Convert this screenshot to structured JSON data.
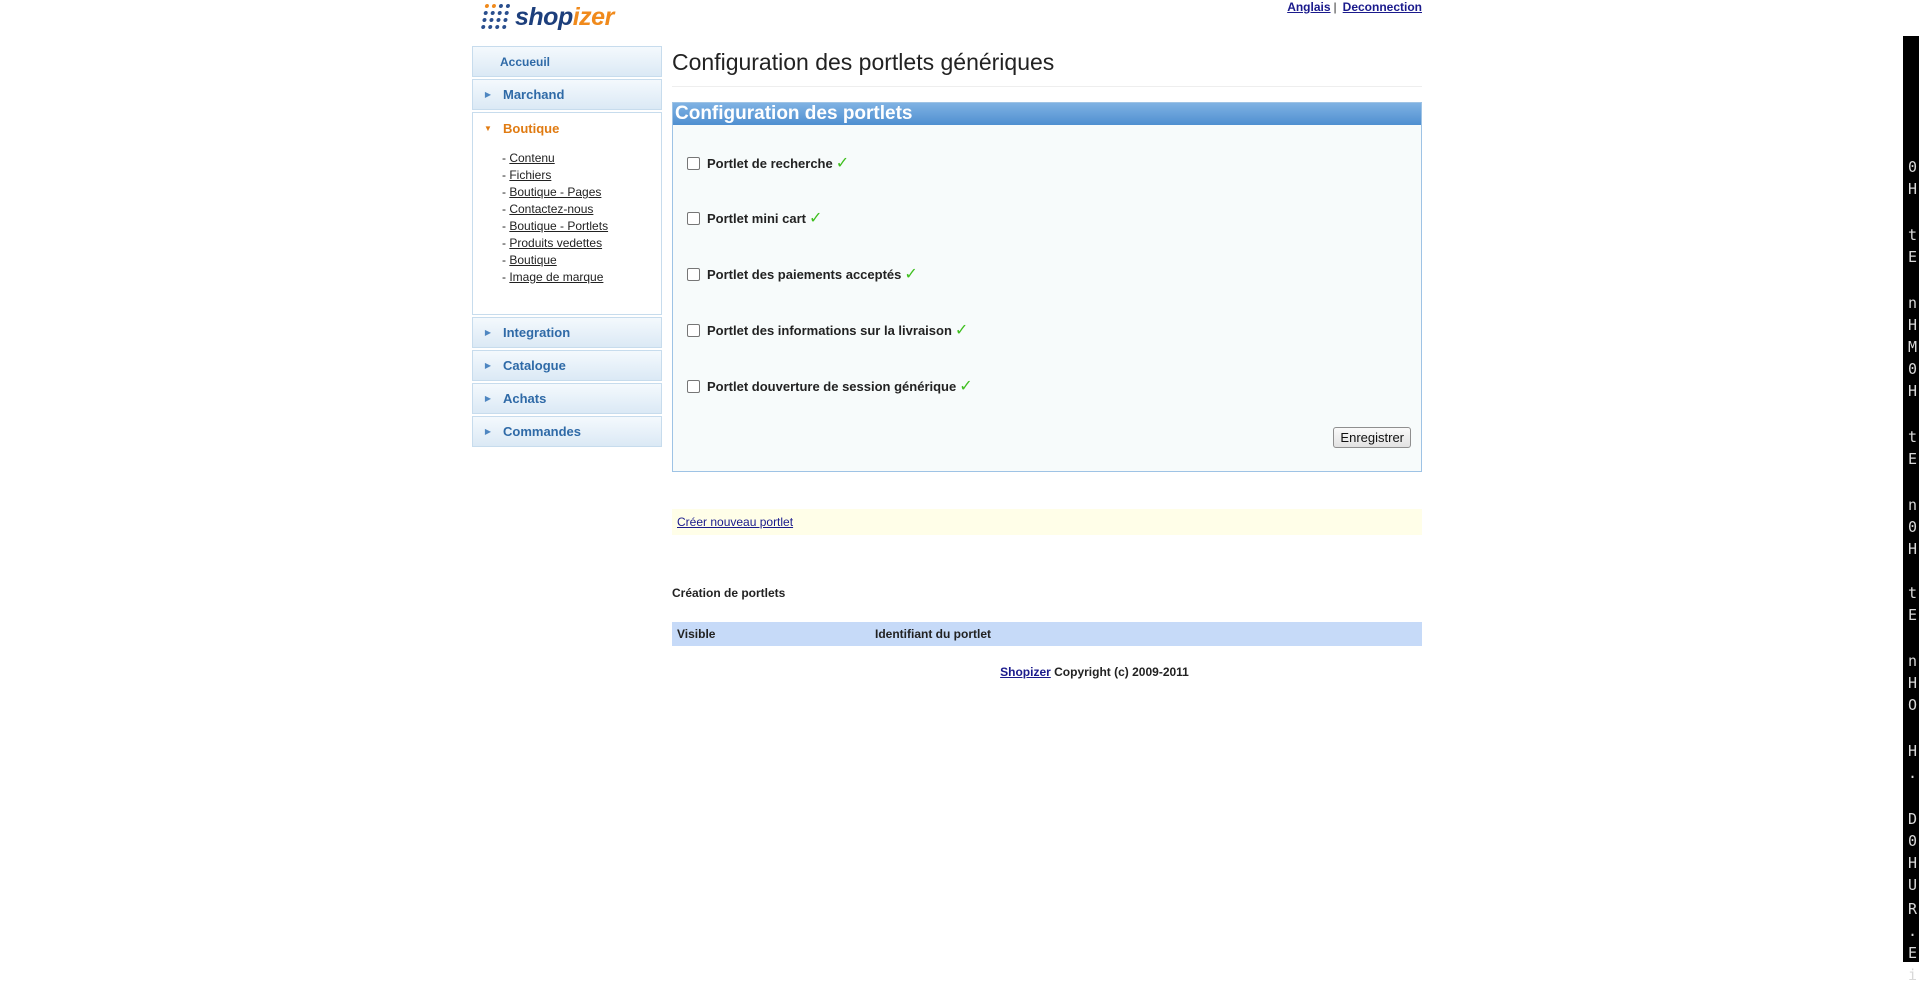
{
  "brand": {
    "name_part1": "shop",
    "name_part2": "izer"
  },
  "top_links": {
    "language": "Anglais",
    "logout": "Deconnection"
  },
  "sidebar": {
    "home": "Accueuil",
    "items": [
      {
        "label": "Marchand"
      },
      {
        "label": "Boutique"
      },
      {
        "label": "Integration"
      },
      {
        "label": "Catalogue"
      },
      {
        "label": "Achats"
      },
      {
        "label": "Commandes"
      }
    ],
    "boutique_submenu": [
      "Contenu",
      "Fichiers",
      "Boutique - Pages",
      "Contactez-nous",
      "Boutique - Portlets",
      "Produits vedettes",
      "Boutique",
      "Image de marque"
    ]
  },
  "main": {
    "title": "Configuration des portlets génériques",
    "box_title": "Configuration des portlets",
    "portlets": [
      {
        "label": "Portlet de recherche",
        "checked": false
      },
      {
        "label": "Portlet mini cart",
        "checked": false
      },
      {
        "label": "Portlet des paiements acceptés",
        "checked": false
      },
      {
        "label": "Portlet des informations sur la livraison",
        "checked": false
      },
      {
        "label": "Portlet douverture de session générique",
        "checked": false
      }
    ],
    "save_label": "Enregistrer",
    "create_link": "Créer nouveau portlet",
    "section_title": "Création de portlets",
    "table_headers": [
      "Visible",
      "Identifiant du portlet"
    ]
  },
  "footer": {
    "link": "Shopizer",
    "text": "Copyright (c) 2009-2011"
  },
  "side_terminal_glyphs": [
    "0",
    "H",
    "t",
    "E",
    "n",
    "H",
    "M",
    "0",
    "H",
    "t",
    "E",
    "n",
    "0",
    "H",
    "t",
    "E",
    "n",
    "H",
    "O",
    "H",
    ".",
    "D",
    "0",
    "H",
    "U",
    "R",
    ".",
    "E",
    "i"
  ],
  "colors": {
    "accent_blue": "#2f6aa7",
    "active_orange": "#e07b12",
    "header_blue": "#5b9ad6",
    "check_green": "#3fbf1f"
  }
}
